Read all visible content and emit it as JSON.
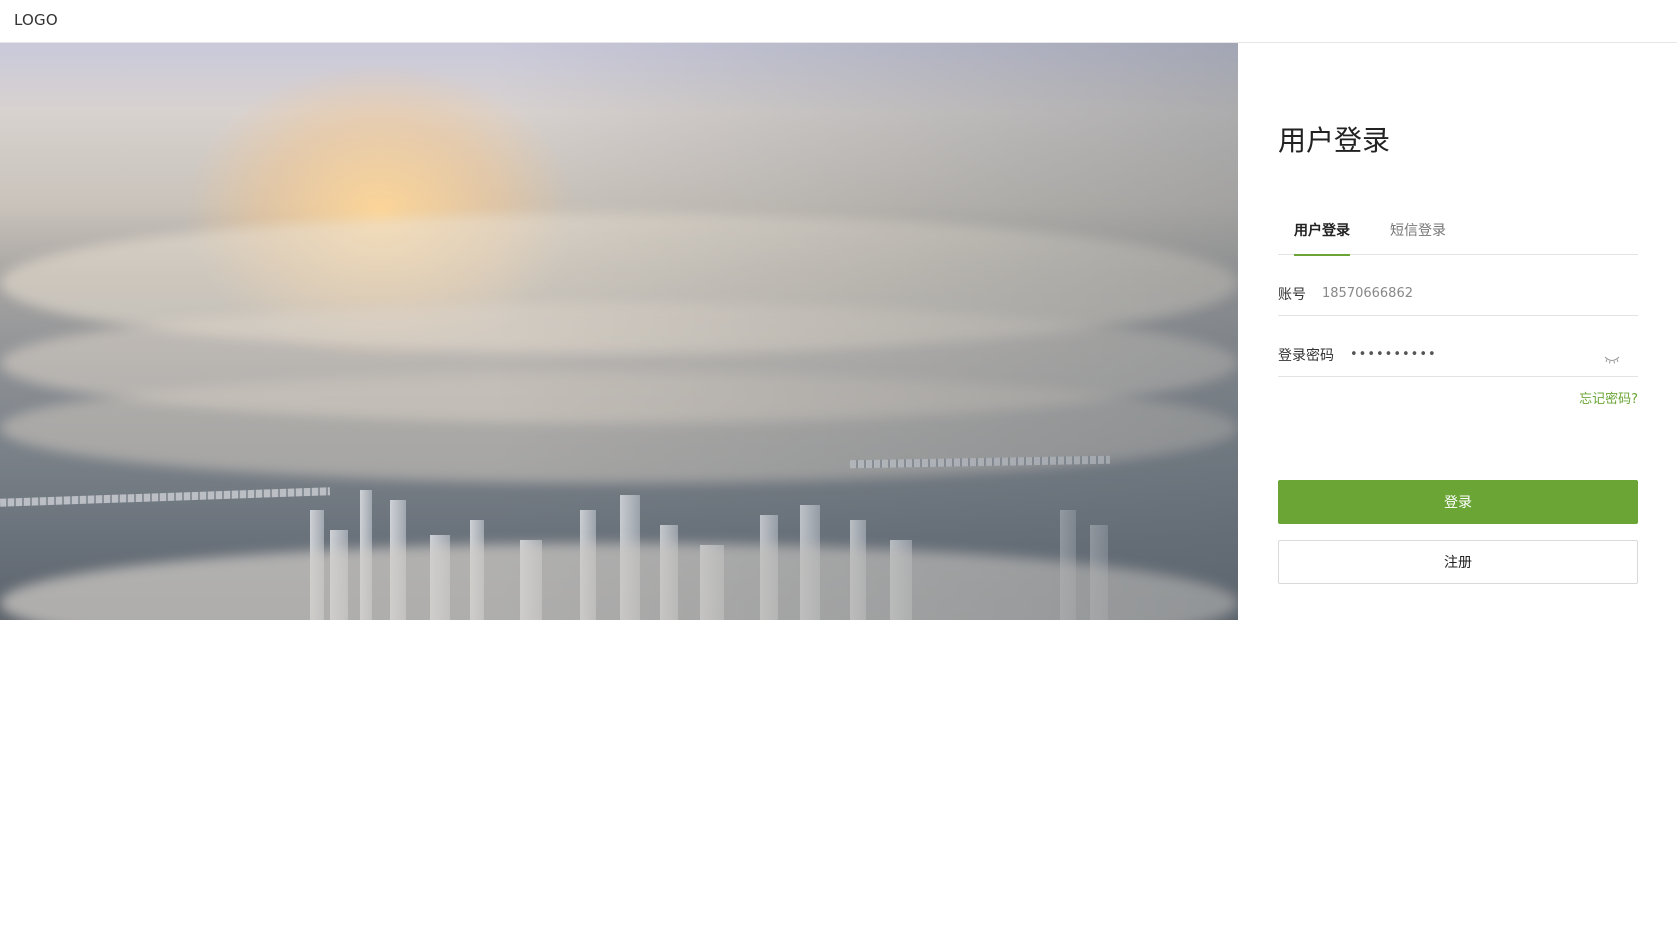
{
  "header": {
    "logo_text": "LOGO"
  },
  "hero": {
    "image_description_icon": "cityscape-above-clouds-image"
  },
  "login": {
    "title": "用户登录",
    "tabs": [
      {
        "label": "用户登录",
        "active": true
      },
      {
        "label": "短信登录",
        "active": false
      }
    ],
    "account": {
      "label": "账号",
      "value": "18570666862",
      "placeholder": ""
    },
    "password": {
      "label": "登录密码",
      "value": "••••••••••",
      "visibility_icon": "eye-closed-icon"
    },
    "forgot_link": "忘记密码?",
    "login_button": "登录",
    "register_button": "注册"
  },
  "colors": {
    "accent": "#6aa536",
    "border": "#e3e3e3",
    "text": "#222222"
  }
}
